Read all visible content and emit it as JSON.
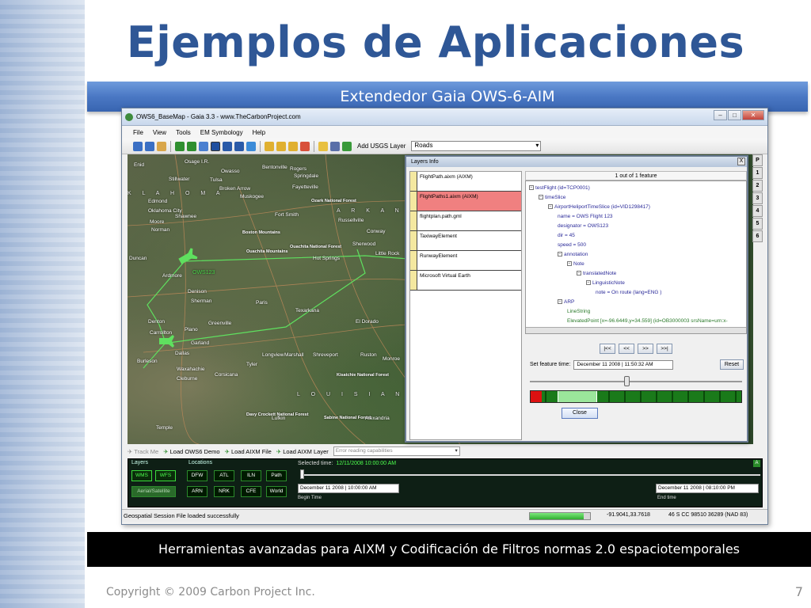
{
  "slide": {
    "title": "Ejemplos de Aplicaciones",
    "subtitle": "Extendedor Gaia OWS-6-AIM",
    "caption": "Herramientas avanzadas para AIXM y Codificación de Filtros  normas 2.0 espaciotemporales",
    "copyright": "Copyright © 2009 Carbon Project Inc.",
    "page_number": "7"
  },
  "window": {
    "title": "OWS6_BaseMap - Gaia 3.3 - www.TheCarbonProject.com",
    "menu": [
      "File",
      "View",
      "Tools",
      "EM Symbology",
      "Help"
    ],
    "toolbar": {
      "add_layer_label": "Add USGS Layer",
      "layer_select": "Roads"
    }
  },
  "map": {
    "labels": [
      "Osage I.R.",
      "Bentonville",
      "Rogers",
      "Springdale",
      "Fayetteville",
      "Enid",
      "Stillwater",
      "Tulsa",
      "Broken Arrow",
      "Owasso",
      "Muskogee",
      "Ozark National Forest",
      "Edmond",
      "Oklahoma City",
      "Moore",
      "Shawnee",
      "Norman",
      "Fort Smith",
      "Russellville",
      "Conway",
      "Sherwood",
      "Little Rock",
      "Ouachita National Forest",
      "Hot Springs",
      "Boston Mountains",
      "Ouachita Mountains",
      "Ardmore",
      "Duncan",
      "Denison",
      "Sherman",
      "Paris",
      "Texarkana",
      "El Dorado",
      "Denton",
      "Plano",
      "Greenville",
      "Carrollton",
      "Garland",
      "Dallas",
      "Burleson",
      "Waxahachie",
      "Cleburne",
      "Tyler",
      "Longview",
      "Marshall",
      "Shreveport",
      "Ruston",
      "Monroe",
      "Davy Crockett National Forest",
      "Sabine National Forest",
      "Kisatchie National Forest",
      "Temple",
      "Alexandria",
      "Lufkin",
      "Corsicana"
    ],
    "state_labels": [
      "K L A H O M A",
      "A R K A N S A S",
      "L O U I S I A N A"
    ],
    "flight_label": "OWS123"
  },
  "right_tabs": [
    "P",
    "1",
    "2",
    "3",
    "4",
    "5",
    "6"
  ],
  "layers_dialog": {
    "title": "Layers Info",
    "close": "X",
    "layers": [
      "FlightPath.aixm (AIXM)",
      "FlightPaths1.aixm (AIXM)",
      "flightplan.path.gml",
      "TaxiwayElement",
      "RunwayElement",
      "Microsoft Virtual Earth"
    ],
    "selected_index": 1,
    "feature_count": "1 out of 1 feature",
    "tree": [
      {
        "depth": 0,
        "box": "⊟",
        "text": "testFlight (id=TCP0001)",
        "color": "blue"
      },
      {
        "depth": 1,
        "box": "⊟",
        "text": "timeSlice",
        "color": "blue"
      },
      {
        "depth": 2,
        "box": "⊟",
        "text": "AirportHeliportTimeSlice (id=VID1298417)",
        "color": "blue"
      },
      {
        "depth": 3,
        "box": "",
        "text": "name = OWS Flight 123",
        "color": "blue"
      },
      {
        "depth": 3,
        "box": "",
        "text": "designator = OWS123",
        "color": "blue"
      },
      {
        "depth": 3,
        "box": "",
        "text": "dir = 45",
        "color": "blue"
      },
      {
        "depth": 3,
        "box": "",
        "text": "speed = 500",
        "color": "blue"
      },
      {
        "depth": 3,
        "box": "⊟",
        "text": "annotation",
        "color": "blue"
      },
      {
        "depth": 4,
        "box": "⊟",
        "text": "Note",
        "color": "blue"
      },
      {
        "depth": 5,
        "box": "⊟",
        "text": "translatedNote",
        "color": "blue"
      },
      {
        "depth": 6,
        "box": "⊟",
        "text": "LinguisticNote",
        "color": "blue"
      },
      {
        "depth": 7,
        "box": "",
        "text": "note = On route (lang=ENG )",
        "color": "blue"
      },
      {
        "depth": 3,
        "box": "⊟",
        "text": "ARP",
        "color": "blue"
      },
      {
        "depth": 4,
        "box": "",
        "text": "LineString",
        "color": "green"
      },
      {
        "depth": 4,
        "box": "",
        "text": "ElevatedPoint [x=-96.6449,y=34.559]  (id=OB3000003 srsName=urn:x-",
        "color": "green"
      }
    ],
    "nav_buttons": [
      "|<<",
      "<<",
      ">>",
      ">>|"
    ],
    "set_time_label": "Set feature time:",
    "set_time_value": "December 11 2008 | 11:50:32 AM",
    "reset": "Reset",
    "close_btn": "Close"
  },
  "bottom_bar": {
    "track": "Track Me",
    "load_demo": "Load OWS6 Demo",
    "load_aixm_file": "Load AIXM File",
    "load_aixm_layer": "Load AIXM Layer",
    "caps_placeholder": "Error reading capabilities"
  },
  "bottom_panel": {
    "layers_label": "Layers",
    "layers": [
      "WMS",
      "WFS",
      "Aerial/Satellite"
    ],
    "locations_label": "Locations",
    "locations": [
      "DFW",
      "ATL",
      "ILN",
      "Path",
      "ARN",
      "NRK",
      "CFE",
      "World"
    ],
    "selected_time_label": "Selected time:",
    "selected_time_value": "12/11/2008 10:00:00 AM",
    "begin_value": "December 11 2008 | 10:00:00 AM",
    "begin_label": "Begin Time",
    "end_value": "December 11 2008 | 08:10:00 PM",
    "end_label": "End time",
    "corner": "A"
  },
  "status": {
    "message": "Geospatial Session File loaded successfully",
    "progress": 0.9,
    "coords": "-91.9041,33.7618",
    "utm": "46 S CC 98510 36289 (NAD 83)"
  }
}
